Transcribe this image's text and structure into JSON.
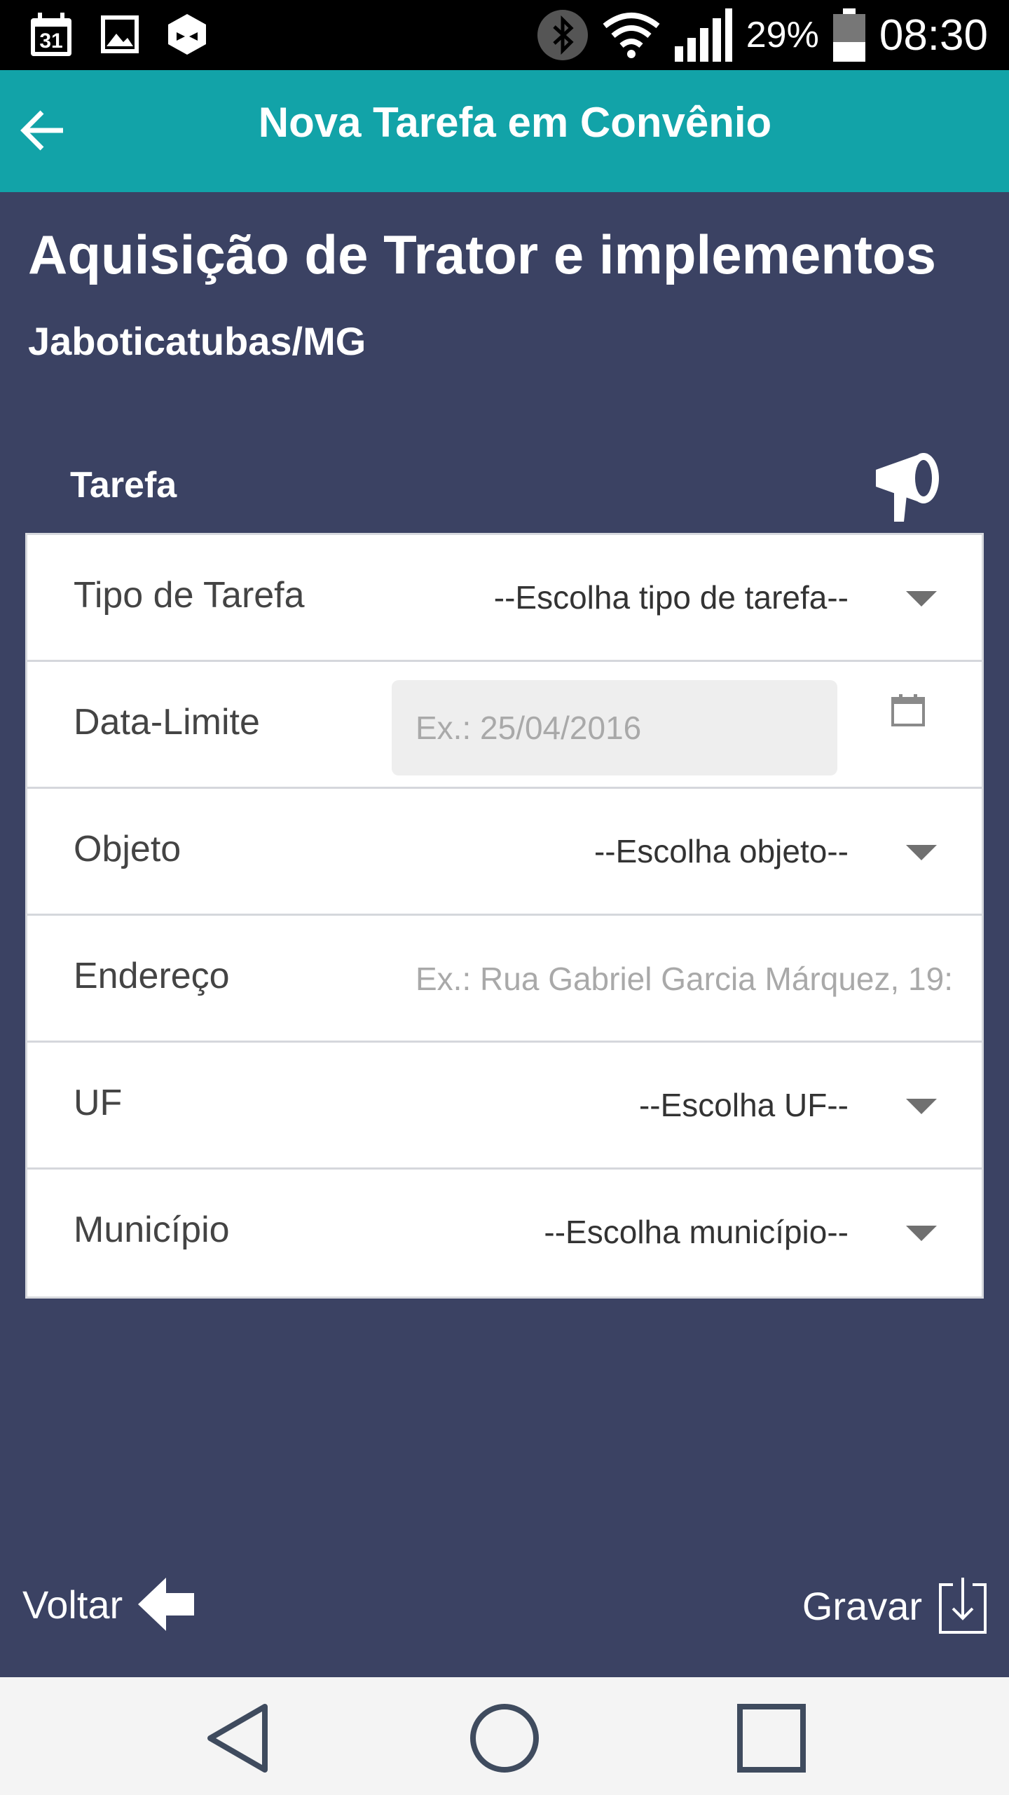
{
  "status_bar": {
    "battery": "29%",
    "time": "08:30",
    "calendar_day": "31"
  },
  "app_bar": {
    "title": "Nova Tarefa em Convênio"
  },
  "header": {
    "title": "Aquisição de Trator e implementos",
    "subtitle": "Jaboticatubas/MG"
  },
  "section": {
    "label": "Tarefa"
  },
  "form": {
    "tipo": {
      "label": "Tipo de Tarefa",
      "value": "--Escolha tipo de tarefa--"
    },
    "data_limite": {
      "label": "Data-Limite",
      "placeholder": "Ex.: 25/04/2016"
    },
    "objeto": {
      "label": "Objeto",
      "value": "--Escolha objeto--"
    },
    "endereco": {
      "label": "Endereço",
      "placeholder": "Ex.: Rua Gabriel Garcia Márquez, 19:"
    },
    "uf": {
      "label": "UF",
      "value": "--Escolha UF--"
    },
    "municipio": {
      "label": "Município",
      "value": "--Escolha município--"
    }
  },
  "footer": {
    "back_label": "Voltar",
    "save_label": "Gravar"
  },
  "colors": {
    "app_bar": "#12a3a8",
    "background": "#3b4263",
    "card": "#ffffff"
  }
}
